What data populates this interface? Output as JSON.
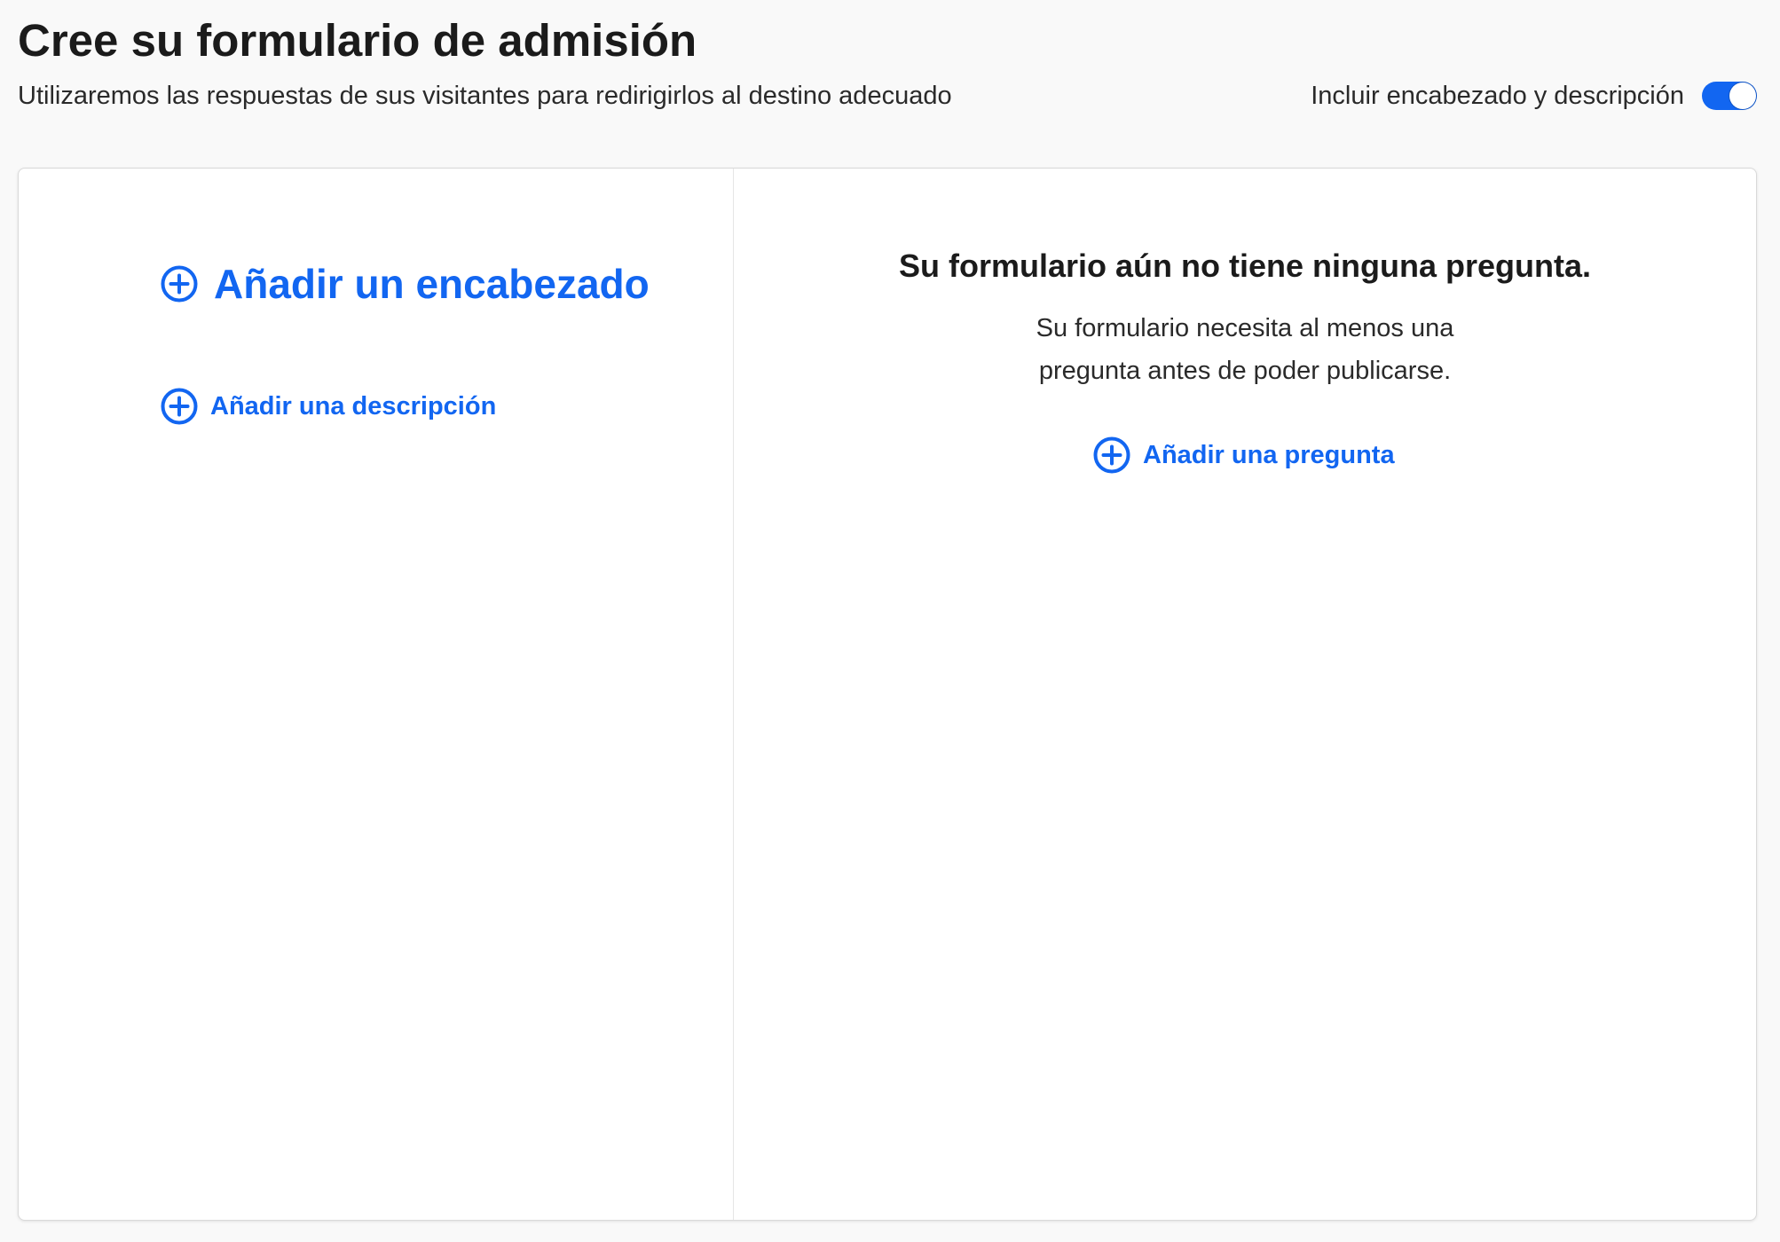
{
  "header": {
    "title": "Cree su formulario de admisión",
    "subtitle": "Utilizaremos las respuestas de sus visitantes para redirigirlos al destino adecuado",
    "toggle_label": "Incluir encabezado y descripción",
    "toggle_on": true
  },
  "left_panel": {
    "add_heading_label": "Añadir un encabezado",
    "add_description_label": "Añadir una descripción"
  },
  "right_panel": {
    "empty_title": "Su formulario aún no tiene ninguna pregunta.",
    "empty_description_line1": "Su formulario necesita al menos una",
    "empty_description_line2": "pregunta antes de poder publicarse.",
    "add_question_label": "Añadir una pregunta"
  },
  "colors": {
    "accent": "#1266f1",
    "background": "#f9f9f9",
    "card": "#ffffff",
    "text": "#1b1b1b"
  },
  "icons": {
    "add": "plus-circle-icon"
  }
}
